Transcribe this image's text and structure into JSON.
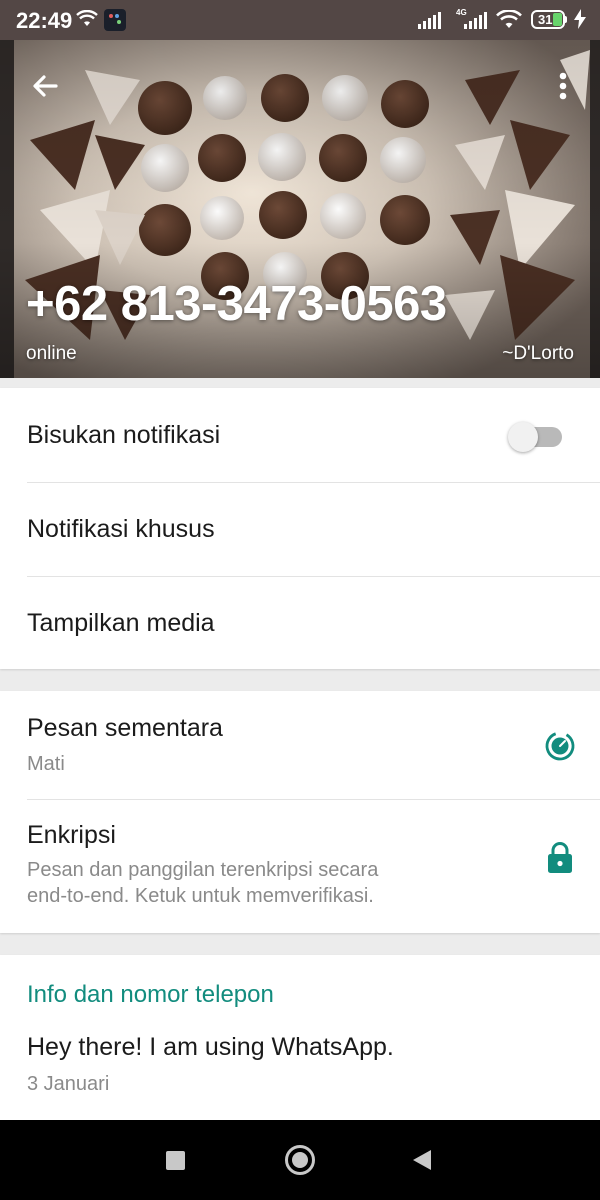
{
  "status_bar": {
    "time": "22:49",
    "battery": "31"
  },
  "header": {
    "contact_name": "+62 813-3473-0563",
    "status": "online",
    "push_name": "~D'Lorto"
  },
  "settings_card": {
    "mute_label": "Bisukan notifikasi",
    "mute_enabled": false,
    "custom_notif_label": "Notifikasi khusus",
    "media_visibility_label": "Tampilkan media"
  },
  "privacy_card": {
    "disappearing_label": "Pesan sementara",
    "disappearing_value": "Mati",
    "encryption_label": "Enkripsi",
    "encryption_desc_line1": "Pesan dan panggilan terenkripsi secara",
    "encryption_desc_line2": "end-to-end. Ketuk untuk memverifikasi."
  },
  "about_card": {
    "section_title": "Info dan nomor telepon",
    "about_text": "Hey there! I am using WhatsApp.",
    "about_date": "3 Januari"
  },
  "colors": {
    "accent": "#128c7e",
    "status_bar": "#534745",
    "nav_bar": "#000000"
  },
  "icons": {
    "back": "arrow-left-icon",
    "menu": "more-vertical-icon",
    "timer": "disappearing-timer-icon",
    "lock": "lock-icon"
  }
}
